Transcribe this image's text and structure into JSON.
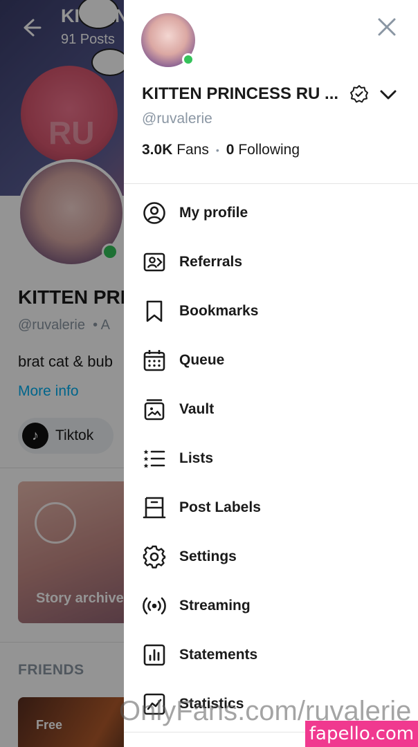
{
  "background_page": {
    "title": "KITTEN",
    "posts_count": "91 Posts",
    "name": "KITTEN PRI",
    "handle": "@ruvalerie",
    "handle_suffix": "•  A",
    "bio": "brat cat & bub",
    "more_info": "More info",
    "social_chip": "Tiktok",
    "story_archive": "Story archive",
    "friends_header": "FRIENDS",
    "friend_card_badge": "Free",
    "cover_watermark": "RU"
  },
  "drawer": {
    "name": "KITTEN PRINCESS RU ...",
    "handle": "@ruvalerie",
    "fans_count": "3.0K",
    "fans_label": "Fans",
    "following_count": "0",
    "following_label": "Following",
    "menu": [
      {
        "label": "My profile",
        "icon": "user-circle-icon"
      },
      {
        "label": "Referrals",
        "icon": "referrals-icon"
      },
      {
        "label": "Bookmarks",
        "icon": "bookmark-icon"
      },
      {
        "label": "Queue",
        "icon": "calendar-icon"
      },
      {
        "label": "Vault",
        "icon": "vault-icon"
      },
      {
        "label": "Lists",
        "icon": "lists-icon"
      },
      {
        "label": "Post Labels",
        "icon": "post-labels-icon"
      },
      {
        "label": "Settings",
        "icon": "gear-icon"
      },
      {
        "label": "Streaming",
        "icon": "streaming-icon"
      },
      {
        "label": "Statements",
        "icon": "statements-icon"
      },
      {
        "label": "Statistics",
        "icon": "statistics-icon"
      }
    ]
  },
  "watermarks": {
    "onlyfans": "OnlyFans.com/ruvalerie",
    "fapello": "fapello.com"
  },
  "colors": {
    "online": "#35c25a",
    "link": "#00aff0",
    "muted": "#8a96a3",
    "fapello": "#f0398f"
  }
}
